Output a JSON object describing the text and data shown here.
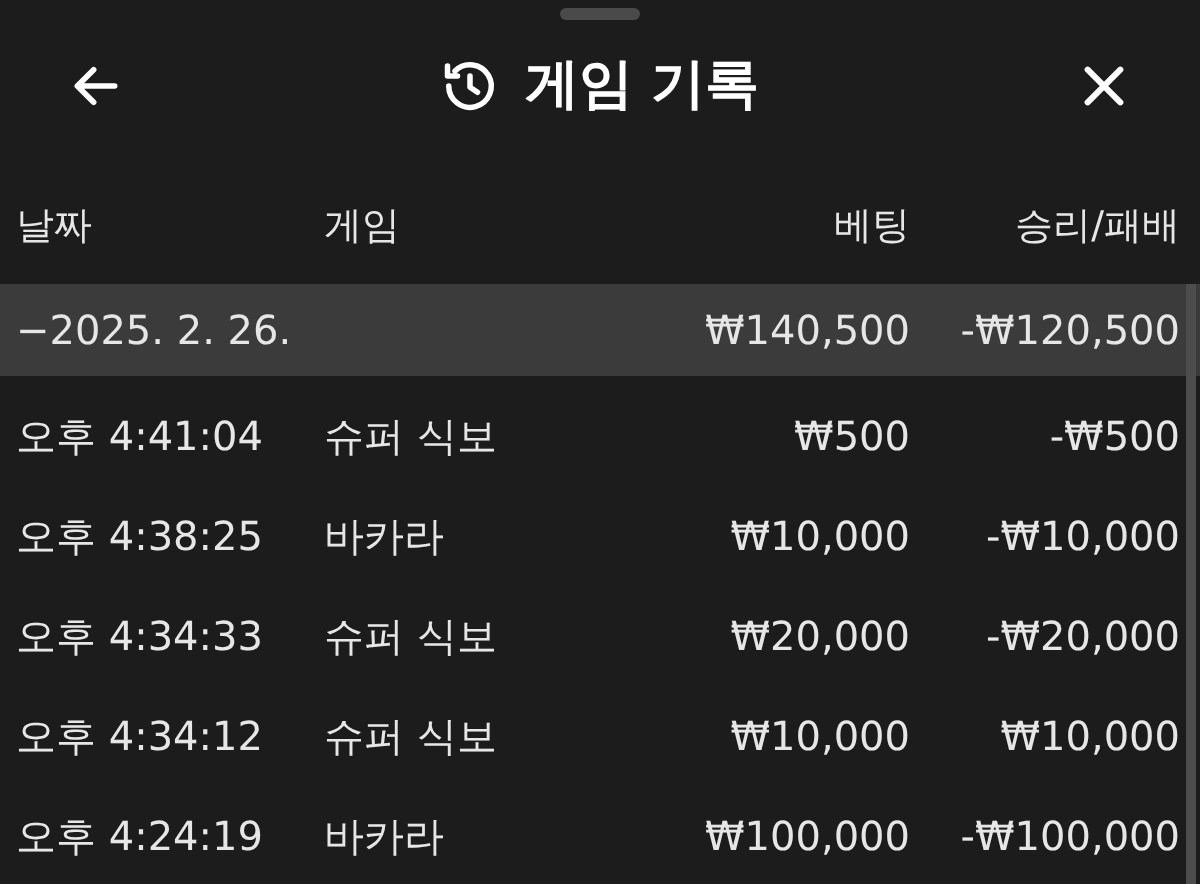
{
  "header": {
    "title": "게임 기록"
  },
  "table": {
    "columns": [
      "날짜",
      "게임",
      "베팅",
      "승리/패배"
    ],
    "group": {
      "date": "−2025. 2. 26.",
      "bet": "₩140,500",
      "result": "-₩120,500"
    },
    "rows": [
      {
        "time": "오후 4:41:04",
        "game": "슈퍼 식보",
        "bet": "₩500",
        "result": "-₩500"
      },
      {
        "time": "오후 4:38:25",
        "game": "바카라",
        "bet": "₩10,000",
        "result": "-₩10,000"
      },
      {
        "time": "오후 4:34:33",
        "game": "슈퍼 식보",
        "bet": "₩20,000",
        "result": "-₩20,000"
      },
      {
        "time": "오후 4:34:12",
        "game": "슈퍼 식보",
        "bet": "₩10,000",
        "result": "₩10,000"
      },
      {
        "time": "오후 4:24:19",
        "game": "바카라",
        "bet": "₩100,000",
        "result": "-₩100,000"
      }
    ]
  }
}
